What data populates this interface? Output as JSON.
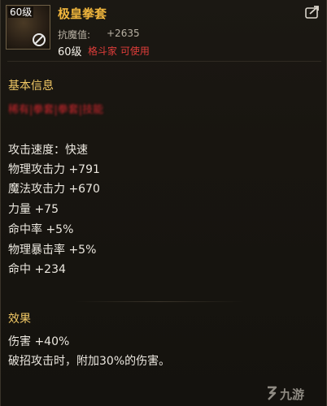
{
  "item": {
    "level_badge": "60级",
    "name": "极皇拳套",
    "resist_label": "抗魔值:",
    "resist_value": "+2635",
    "req_level": "60级",
    "req_class": "格斗家 可使用"
  },
  "basic": {
    "title": "基本信息",
    "blurred_text": "稀有|拳套|拳套|技能",
    "stats": [
      "攻击速度：快速",
      "物理攻击力 +791",
      "魔法攻击力 +670",
      "力量 +75",
      "命中率 +5%",
      "物理暴击率 +5%",
      "命中 +234"
    ]
  },
  "effect": {
    "title": "效果",
    "lines": [
      "伤害 +40%",
      "破招攻击时，附加30%的伤害。"
    ]
  },
  "watermark": {
    "text": "九游"
  },
  "icons": {
    "item": "knuckle-gauntlet-icon",
    "restriction": "no-entry-icon",
    "share": "share-icon",
    "watermark_logo": "jiuyou-logo"
  },
  "colors": {
    "name": "#f1b63d",
    "section_title": "#f1c865",
    "class_restriction": "#e03d3a",
    "stat_text": "#ebe7df"
  }
}
